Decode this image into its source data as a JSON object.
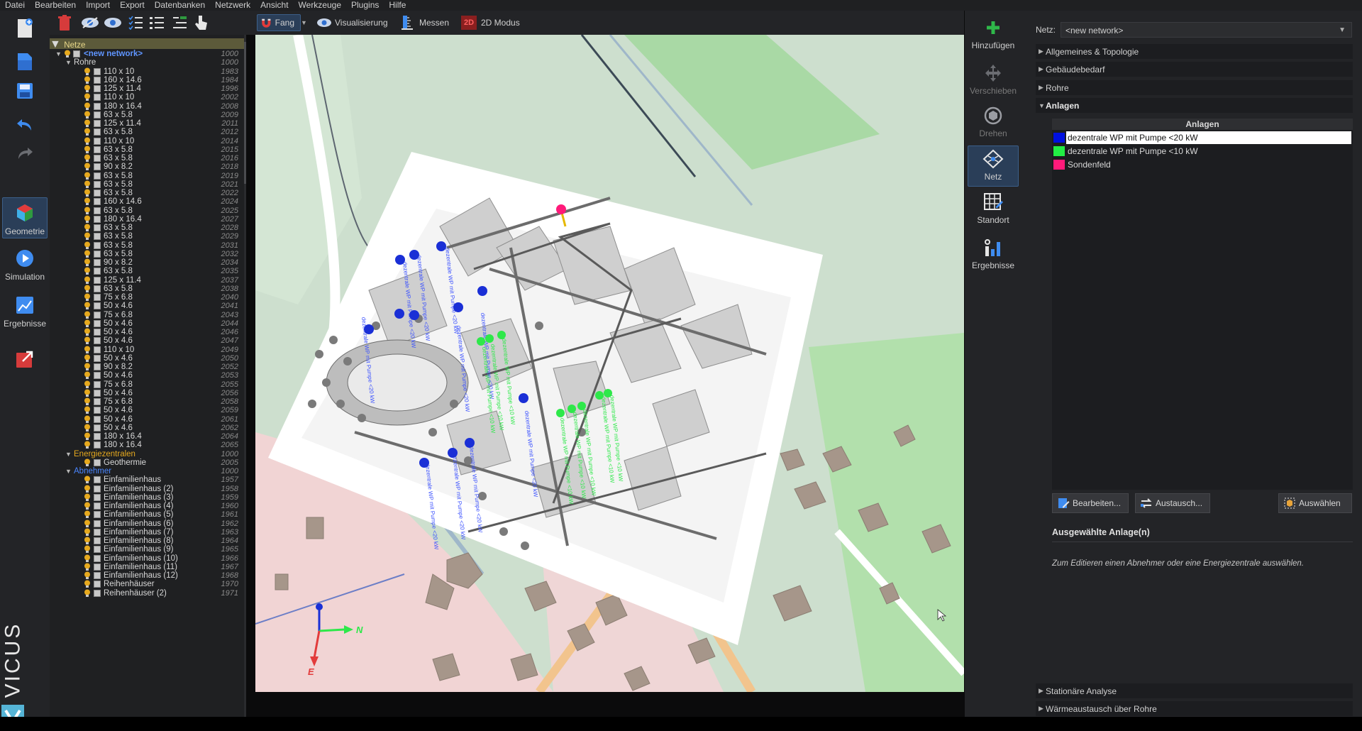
{
  "menubar": {
    "items": [
      "Datei",
      "Bearbeiten",
      "Import",
      "Export",
      "Datenbanken",
      "Netzwerk",
      "Ansicht",
      "Werkzeuge",
      "Plugins",
      "Hilfe"
    ]
  },
  "sidebar": {
    "geometry": "Geometrie",
    "simulation": "Simulation",
    "results": "Ergebnisse",
    "brand": "VICUS"
  },
  "viewbar": {
    "snap": "Fang",
    "visualization": "Visualisierung",
    "measure": "Messen",
    "mode_badge": "2D",
    "mode": "2D Modus"
  },
  "tree": {
    "root": "Netze",
    "network": {
      "name": "<new network>",
      "id": "1000"
    },
    "pipes_group": {
      "name": "Rohre",
      "id": "1000"
    },
    "pipes": [
      {
        "name": "110 x 10",
        "id": "1983"
      },
      {
        "name": "160 x 14.6",
        "id": "1984"
      },
      {
        "name": "125 x 11.4",
        "id": "1996"
      },
      {
        "name": "110 x 10",
        "id": "2002"
      },
      {
        "name": "180 x 16.4",
        "id": "2008"
      },
      {
        "name": "63 x 5.8",
        "id": "2009"
      },
      {
        "name": "125 x 11.4",
        "id": "2011"
      },
      {
        "name": "63 x 5.8",
        "id": "2012"
      },
      {
        "name": "110 x 10",
        "id": "2014"
      },
      {
        "name": "63 x 5.8",
        "id": "2015"
      },
      {
        "name": "63 x 5.8",
        "id": "2016"
      },
      {
        "name": "90 x 8.2",
        "id": "2018"
      },
      {
        "name": "63 x 5.8",
        "id": "2019"
      },
      {
        "name": "63 x 5.8",
        "id": "2021"
      },
      {
        "name": "63 x 5.8",
        "id": "2022"
      },
      {
        "name": "160 x 14.6",
        "id": "2024"
      },
      {
        "name": "63 x 5.8",
        "id": "2025"
      },
      {
        "name": "180 x 16.4",
        "id": "2027"
      },
      {
        "name": "63 x 5.8",
        "id": "2028"
      },
      {
        "name": "63 x 5.8",
        "id": "2029"
      },
      {
        "name": "63 x 5.8",
        "id": "2031"
      },
      {
        "name": "63 x 5.8",
        "id": "2032"
      },
      {
        "name": "90 x 8.2",
        "id": "2034"
      },
      {
        "name": "63 x 5.8",
        "id": "2035"
      },
      {
        "name": "125 x 11.4",
        "id": "2037"
      },
      {
        "name": "63 x 5.8",
        "id": "2038"
      },
      {
        "name": "75 x 6.8",
        "id": "2040"
      },
      {
        "name": "50 x 4.6",
        "id": "2041"
      },
      {
        "name": "75 x 6.8",
        "id": "2043"
      },
      {
        "name": "50 x 4.6",
        "id": "2044"
      },
      {
        "name": "50 x 4.6",
        "id": "2046"
      },
      {
        "name": "50 x 4.6",
        "id": "2047"
      },
      {
        "name": "110 x 10",
        "id": "2049"
      },
      {
        "name": "50 x 4.6",
        "id": "2050"
      },
      {
        "name": "90 x 8.2",
        "id": "2052"
      },
      {
        "name": "50 x 4.6",
        "id": "2053"
      },
      {
        "name": "75 x 6.8",
        "id": "2055"
      },
      {
        "name": "50 x 4.6",
        "id": "2056"
      },
      {
        "name": "75 x 6.8",
        "id": "2058"
      },
      {
        "name": "50 x 4.6",
        "id": "2059"
      },
      {
        "name": "50 x 4.6",
        "id": "2061"
      },
      {
        "name": "50 x 4.6",
        "id": "2062"
      },
      {
        "name": "180 x 16.4",
        "id": "2064"
      },
      {
        "name": "180 x 16.4",
        "id": "2065"
      }
    ],
    "energy_group": {
      "name": "Energiezentralen",
      "id": "1000"
    },
    "energy": [
      {
        "name": "Geothermie",
        "id": "2005"
      }
    ],
    "consumer_group": {
      "name": "Abnehmer",
      "id": "1000"
    },
    "consumers": [
      {
        "name": "Einfamilienhaus",
        "id": "1957"
      },
      {
        "name": "Einfamilienhaus (2)",
        "id": "1958"
      },
      {
        "name": "Einfamilienhaus (3)",
        "id": "1959"
      },
      {
        "name": "Einfamilienhaus (4)",
        "id": "1960"
      },
      {
        "name": "Einfamilienhaus (5)",
        "id": "1961"
      },
      {
        "name": "Einfamilienhaus (6)",
        "id": "1962"
      },
      {
        "name": "Einfamilienhaus (7)",
        "id": "1963"
      },
      {
        "name": "Einfamilienhaus (8)",
        "id": "1964"
      },
      {
        "name": "Einfamilienhaus (9)",
        "id": "1965"
      },
      {
        "name": "Einfamilienhaus (10)",
        "id": "1966"
      },
      {
        "name": "Einfamilienhaus (11)",
        "id": "1967"
      },
      {
        "name": "Einfamilienhaus (12)",
        "id": "1968"
      },
      {
        "name": "Reihenhäuser",
        "id": "1970"
      },
      {
        "name": "Reihenhäuser (2)",
        "id": "1971"
      }
    ]
  },
  "viewport": {
    "axis_n": "N",
    "axis_e": "E",
    "plan_label_blue": "dezentrale WP mit Pumpe <20 kW",
    "plan_label_green": "dezentrale WP mit Pumpe <10 kW"
  },
  "rtools": {
    "add": "Hinzufügen",
    "move": "Verschieben",
    "rotate": "Drehen",
    "network": "Netz",
    "location": "Standort",
    "results": "Ergebnisse"
  },
  "rpanel": {
    "net_label": "Netz:",
    "net_value": "<new network>",
    "sections": {
      "general": "Allgemeines & Topologie",
      "demand": "Gebäudebedarf",
      "pipes": "Rohre",
      "plants": "Anlagen",
      "stationary": "Stationäre Analyse",
      "heat_exchange": "Wärmeaustausch über Rohre"
    },
    "plants_table": {
      "header": "Anlagen",
      "rows": [
        {
          "label": "dezentrale WP mit Pumpe <20 kW",
          "color": "#0010e0"
        },
        {
          "label": "dezentrale WP mit Pumpe <10 kW",
          "color": "#22ee44"
        },
        {
          "label": "Sondenfeld",
          "color": "#ff1a7a"
        }
      ]
    },
    "buttons": {
      "edit": "Bearbeiten...",
      "exchange": "Austausch...",
      "select": "Auswählen"
    },
    "selected_title": "Ausgewählte Anlage(n)",
    "selected_hint": "Zum Editieren einen Abnehmer oder eine Energiezentrale auswählen."
  },
  "colors": {
    "accent": "#3c5f89",
    "category": "#e6a91e",
    "selected_network": "#5f95ff",
    "blue_node": "#1a2fd6",
    "green_node": "#2ee84a",
    "pink_node": "#ff1a7a"
  }
}
